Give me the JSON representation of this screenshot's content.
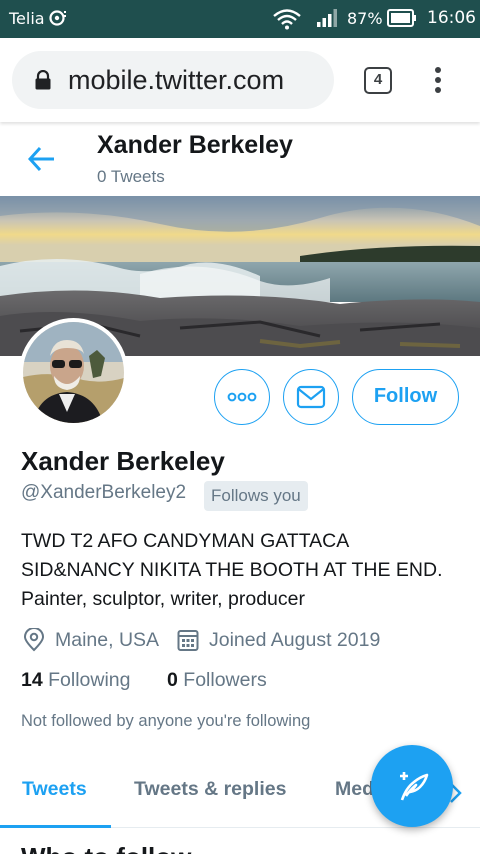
{
  "status_bar": {
    "carrier": "Telia",
    "battery_percent": "87%",
    "time": "16:06",
    "icons": [
      "carrier-icon",
      "wifi-icon",
      "signal-icon",
      "battery-icon"
    ]
  },
  "browser": {
    "url": "mobile.twitter.com",
    "tab_count": "4",
    "icons": [
      "lock-icon",
      "tabs-icon",
      "overflow-menu-icon"
    ]
  },
  "header": {
    "name": "Xander Berkeley",
    "tweet_count": "0 Tweets"
  },
  "profile": {
    "name": "Xander Berkeley",
    "handle": "@XanderBerkeley2",
    "follows_you": "Follows you",
    "bio_line1": "TWD T2 AFO CANDYMAN GATTACA",
    "bio_line2": "SID&NANCY NIKITA THE BOOTH AT THE END.",
    "bio_line3": "Painter, sculptor, writer, producer",
    "location": "Maine, USA",
    "joined": "Joined August 2019",
    "following_count": "14",
    "following_label": "Following",
    "followers_count": "0",
    "followers_label": "Followers",
    "not_followed": "Not followed by anyone you're following"
  },
  "actions": {
    "follow_label": "Follow",
    "icons": [
      "more-icon",
      "message-icon"
    ]
  },
  "tabs": [
    {
      "label": "Tweets",
      "active": true
    },
    {
      "label": "Tweets & replies",
      "active": false
    },
    {
      "label": "Med",
      "active": false
    }
  ],
  "section": {
    "who_to_follow": "Who to follow"
  },
  "colors": {
    "accent": "#1da1f2",
    "status_bar": "#1f4f4e",
    "secondary_text": "#657786"
  }
}
